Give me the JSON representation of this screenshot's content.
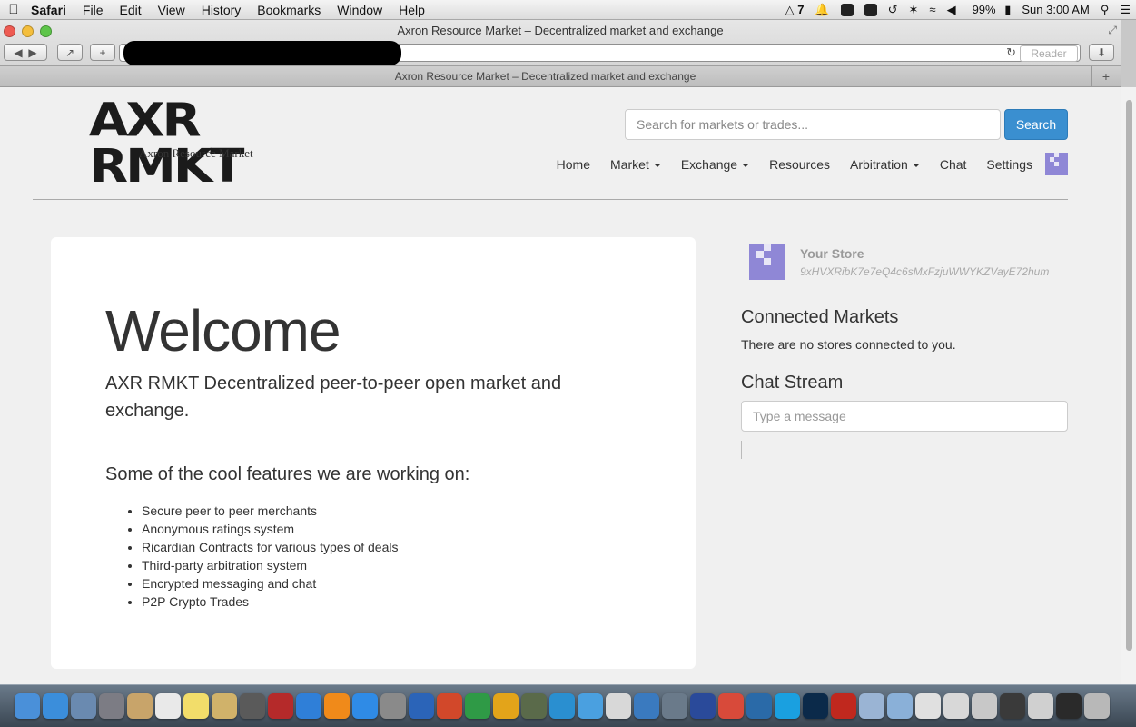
{
  "menubar": {
    "items": [
      "Safari",
      "File",
      "Edit",
      "View",
      "History",
      "Bookmarks",
      "Window",
      "Help"
    ],
    "status_count": "7",
    "battery": "99%",
    "clock": "Sun 3:00 AM"
  },
  "browser": {
    "window_title": "Axron Resource Market – Decentralized market and exchange",
    "tab_title": "Axron Resource Market – Decentralized market and exchange",
    "reader_label": "Reader"
  },
  "site": {
    "logo_mark": "AXR RMKT",
    "logo_subtitle": "Axron Resource Market",
    "search_placeholder": "Search for markets or trades...",
    "search_button": "Search",
    "nav": {
      "home": "Home",
      "market": "Market",
      "exchange": "Exchange",
      "resources": "Resources",
      "arbitration": "Arbitration",
      "chat": "Chat",
      "settings": "Settings"
    }
  },
  "main": {
    "welcome": "Welcome",
    "lead": "AXR RMKT Decentralized peer-to-peer open market and exchange.",
    "features_title": "Some of the cool features we are working on:",
    "features": [
      "Secure peer to peer merchants",
      "Anonymous ratings system",
      "Ricardian Contracts for various types of deals",
      "Third-party arbitration system",
      "Encrypted messaging and chat",
      "P2P Crypto Trades"
    ]
  },
  "sidebar": {
    "store_title": "Your Store",
    "store_id": "9xHVXRibK7e7eQ4c6sMxFzjuWWYKZVayE72hum",
    "connected_heading": "Connected Markets",
    "connected_text": "There are no stores connected to you.",
    "chat_heading": "Chat Stream",
    "chat_placeholder": "Type a message"
  },
  "colors": {
    "accent_blue": "#3a8fd0",
    "avatar_purple": "#8f87d6",
    "page_bg": "#f0f0f0"
  },
  "dock_icons": [
    {
      "name": "finder-icon",
      "color": "#4a90d9"
    },
    {
      "name": "safari-icon",
      "color": "#3b8edb"
    },
    {
      "name": "preview-icon",
      "color": "#6a8ab0"
    },
    {
      "name": "rocket-icon",
      "color": "#7c7c84"
    },
    {
      "name": "address-book-icon",
      "color": "#c8a46a"
    },
    {
      "name": "calendar-icon",
      "color": "#e9e9e9"
    },
    {
      "name": "notes-icon",
      "color": "#f2dd6a"
    },
    {
      "name": "image-viewer-icon",
      "color": "#d0b26a"
    },
    {
      "name": "facetime-icon",
      "color": "#5a5a5a"
    },
    {
      "name": "photo-booth-icon",
      "color": "#b52a2a"
    },
    {
      "name": "itunes-icon",
      "color": "#2f7fd8"
    },
    {
      "name": "ibooks-icon",
      "color": "#f08a1a"
    },
    {
      "name": "app-store-icon",
      "color": "#2f8be6"
    },
    {
      "name": "utility-icon",
      "color": "#8a8a8a"
    },
    {
      "name": "word-icon",
      "color": "#2b64b8"
    },
    {
      "name": "powerpoint-icon",
      "color": "#d2482a"
    },
    {
      "name": "excel-icon",
      "color": "#2f9a46"
    },
    {
      "name": "outlook-icon",
      "color": "#e3a41a"
    },
    {
      "name": "camera-icon",
      "color": "#5a6a4a"
    },
    {
      "name": "c-app-icon",
      "color": "#2a8fd0"
    },
    {
      "name": "messenger-icon",
      "color": "#4aa0e0"
    },
    {
      "name": "crystal-icon",
      "color": "#d8d8d8"
    },
    {
      "name": "globe-icon",
      "color": "#3a7abf"
    },
    {
      "name": "wrench-icon",
      "color": "#6a7a8a"
    },
    {
      "name": "star-icon",
      "color": "#2a4a9a"
    },
    {
      "name": "chrome-icon",
      "color": "#d84a3a"
    },
    {
      "name": "thunderbird-icon",
      "color": "#2a6aa8"
    },
    {
      "name": "skype-icon",
      "color": "#1aa0e0"
    },
    {
      "name": "photoshop-icon",
      "color": "#0b2a4a"
    },
    {
      "name": "filezilla-icon",
      "color": "#c0281e"
    },
    {
      "name": "folder-icon",
      "color": "#9ab4d4"
    },
    {
      "name": "applications-folder-icon",
      "color": "#8ab0d8"
    },
    {
      "name": "downloads-stack-icon",
      "color": "#e0e0e0"
    },
    {
      "name": "document-stack-icon",
      "color": "#d8d8d8"
    },
    {
      "name": "screenshot-stack-icon",
      "color": "#c8c8c8"
    },
    {
      "name": "window-stack-icon",
      "color": "#3a3a3a"
    },
    {
      "name": "file-stack-icon",
      "color": "#d0d0d0"
    },
    {
      "name": "terminal-stack-icon",
      "color": "#2a2a2a"
    },
    {
      "name": "trash-icon",
      "color": "#b8b8b8"
    }
  ]
}
